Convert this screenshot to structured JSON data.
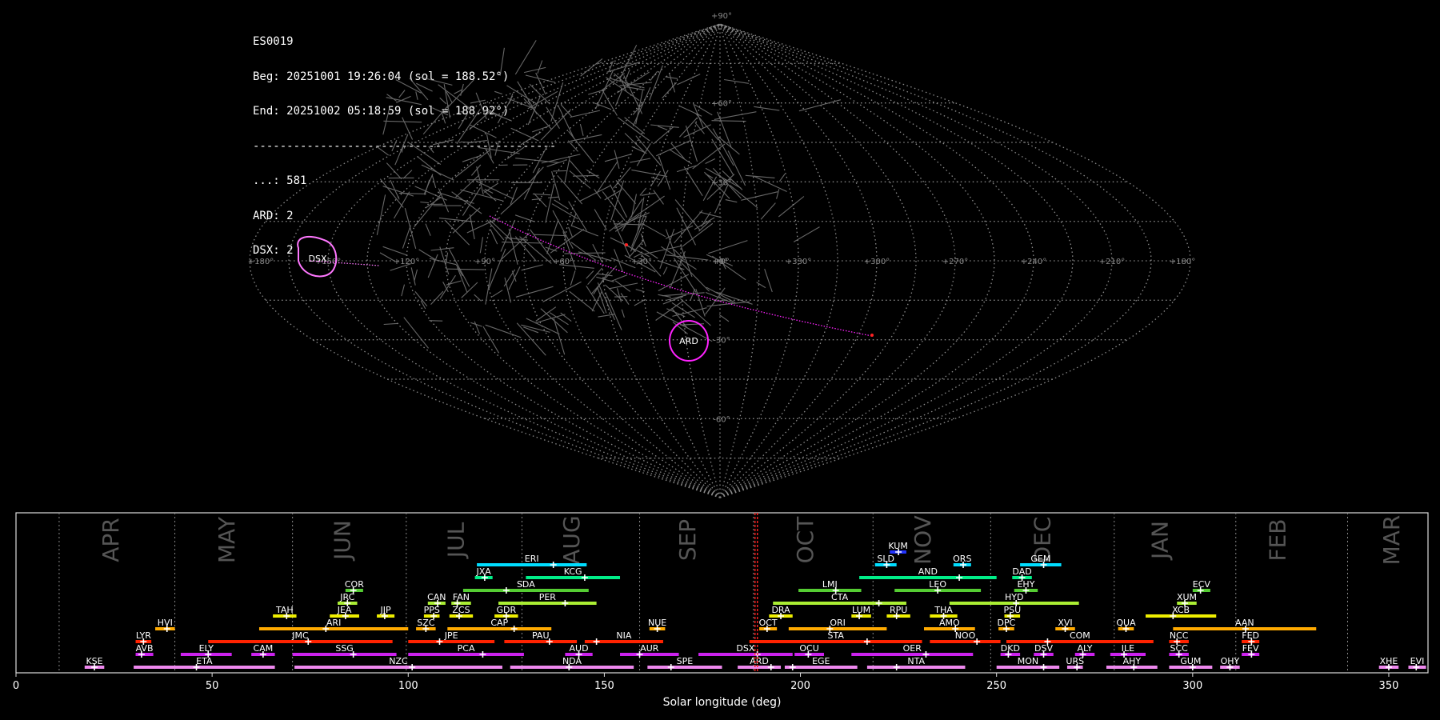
{
  "info": {
    "station": "ES0019",
    "begin": "Beg: 20251001 19:26:04 (sol = 188.52°)",
    "end": "End: 20251002 05:18:59 (sol = 188.92°)",
    "separator": "---------------------------------------------",
    "counts": [
      "...: 581",
      "ARD: 2",
      "DSX: 2"
    ]
  },
  "chart_data": [
    {
      "type": "scatter",
      "projection": "sinusoidal",
      "lat_ticks": [
        "+90°",
        "+60°",
        "+30°",
        "+0°",
        "-30°",
        "-60°",
        "-90°"
      ],
      "lon_ticks": [
        "+180°",
        "+150°",
        "+120°",
        "+90°",
        "+60°",
        "+30°",
        "+0°",
        "+330°",
        "+300°",
        "+270°",
        "+240°",
        "+210°",
        "+180°"
      ],
      "radiants": [
        {
          "code": "DSX",
          "color": "#ff77ff"
        },
        {
          "code": "ARD",
          "color": "#ff22ff"
        }
      ]
    },
    {
      "type": "bar",
      "xlabel": "Solar longitude (deg)",
      "xlim": [
        0,
        360
      ],
      "xticks": [
        0,
        50,
        100,
        150,
        200,
        250,
        300,
        350
      ],
      "months": [
        {
          "label": "APR",
          "x": 24.5
        },
        {
          "label": "MAY",
          "x": 54
        },
        {
          "label": "JUN",
          "x": 83.5
        },
        {
          "label": "JUL",
          "x": 112.5
        },
        {
          "label": "AUG",
          "x": 142
        },
        {
          "label": "SEP",
          "x": 171.5
        },
        {
          "label": "OCT",
          "x": 201.5
        },
        {
          "label": "NOV",
          "x": 231.5
        },
        {
          "label": "DEC",
          "x": 262
        },
        {
          "label": "JAN",
          "x": 292
        },
        {
          "label": "FEB",
          "x": 322
        },
        {
          "label": "MAR",
          "x": 351
        }
      ],
      "month_boundaries": [
        11,
        40.5,
        70.5,
        99.5,
        129,
        159,
        188,
        218.5,
        248.5,
        280,
        311,
        339.5
      ],
      "current_sol": 188.72,
      "showers": [
        {
          "code": "KUM",
          "start": 222.8,
          "end": 227,
          "peak": 225,
          "row": 9,
          "color": "#2233ff"
        },
        {
          "code": "ERI",
          "start": 117.5,
          "end": 145.5,
          "peak": 137,
          "row": 8,
          "color": "#00ddff"
        },
        {
          "code": "SLD",
          "start": 219,
          "end": 224.5,
          "peak": 222,
          "row": 8,
          "color": "#00ddff"
        },
        {
          "code": "ORS",
          "start": 239,
          "end": 243.5,
          "peak": 241.5,
          "row": 8,
          "color": "#00ddff"
        },
        {
          "code": "GEM",
          "start": 256,
          "end": 266.5,
          "peak": 262,
          "row": 8,
          "color": "#00ddff"
        },
        {
          "code": "JXA",
          "start": 117,
          "end": 121.5,
          "peak": 119.5,
          "row": 7,
          "color": "#00ee88"
        },
        {
          "code": "KCG",
          "start": 130,
          "end": 154,
          "peak": 145,
          "row": 7,
          "color": "#00ee88"
        },
        {
          "code": "AND",
          "start": 215,
          "end": 250,
          "peak": 240.5,
          "row": 7,
          "color": "#00ee88"
        },
        {
          "code": "DAD",
          "start": 254,
          "end": 259,
          "peak": 256.5,
          "row": 7,
          "color": "#00ee88"
        },
        {
          "code": "COR",
          "start": 84,
          "end": 88.5,
          "peak": 86,
          "row": 6,
          "color": "#55cc33"
        },
        {
          "code": "SDA",
          "start": 114,
          "end": 146,
          "peak": 125,
          "row": 6,
          "color": "#55cc33"
        },
        {
          "code": "LMI",
          "start": 199.5,
          "end": 215.5,
          "peak": 209,
          "row": 6,
          "color": "#55cc33"
        },
        {
          "code": "LEO",
          "start": 224,
          "end": 246,
          "peak": 235,
          "row": 6,
          "color": "#55cc33"
        },
        {
          "code": "EHY",
          "start": 254.5,
          "end": 260.5,
          "peak": 257.5,
          "row": 6,
          "color": "#55cc33"
        },
        {
          "code": "ECV",
          "start": 300,
          "end": 304.5,
          "peak": 302,
          "row": 6,
          "color": "#55cc33"
        },
        {
          "code": "JRC",
          "start": 82,
          "end": 87,
          "peak": 84.5,
          "row": 5,
          "color": "#aaee33"
        },
        {
          "code": "CAN",
          "start": 105,
          "end": 109.5,
          "peak": 107.5,
          "row": 5,
          "color": "#aaee33"
        },
        {
          "code": "FAN",
          "start": 111,
          "end": 116,
          "peak": 112.5,
          "row": 5,
          "color": "#aaee33"
        },
        {
          "code": "PER",
          "start": 123,
          "end": 148,
          "peak": 140,
          "row": 5,
          "color": "#aaee33"
        },
        {
          "code": "CTA",
          "start": 193,
          "end": 227,
          "peak": 220,
          "row": 5,
          "color": "#aaee33"
        },
        {
          "code": "HYD",
          "start": 238,
          "end": 271,
          "peak": 255,
          "row": 5,
          "color": "#aaee33"
        },
        {
          "code": "XUM",
          "start": 296,
          "end": 301,
          "peak": 298,
          "row": 5,
          "color": "#aaee33"
        },
        {
          "code": "TAH",
          "start": 65.5,
          "end": 71.5,
          "peak": 69,
          "row": 4,
          "color": "#eeee00"
        },
        {
          "code": "JEA",
          "start": 80,
          "end": 87.5,
          "peak": 84,
          "row": 4,
          "color": "#eeee00"
        },
        {
          "code": "JJP",
          "start": 92,
          "end": 96.5,
          "peak": 94,
          "row": 4,
          "color": "#eeee00"
        },
        {
          "code": "PPS",
          "start": 104,
          "end": 108,
          "peak": 106.5,
          "row": 4,
          "color": "#eeee00"
        },
        {
          "code": "ZCS",
          "start": 110.5,
          "end": 116.5,
          "peak": 113,
          "row": 4,
          "color": "#eeee00"
        },
        {
          "code": "GDR",
          "start": 122,
          "end": 128,
          "peak": 125,
          "row": 4,
          "color": "#eeee00"
        },
        {
          "code": "DRA",
          "start": 192,
          "end": 198,
          "peak": 195,
          "row": 4,
          "color": "#eeee00"
        },
        {
          "code": "LUM",
          "start": 213,
          "end": 218,
          "peak": 215,
          "row": 4,
          "color": "#eeee00"
        },
        {
          "code": "RPU",
          "start": 222,
          "end": 228,
          "peak": 224.5,
          "row": 4,
          "color": "#eeee00"
        },
        {
          "code": "THA",
          "start": 233,
          "end": 240,
          "peak": 236.5,
          "row": 4,
          "color": "#eeee00"
        },
        {
          "code": "PSU",
          "start": 252,
          "end": 256,
          "peak": 253.5,
          "row": 4,
          "color": "#eeee00"
        },
        {
          "code": "XCB",
          "start": 288,
          "end": 306,
          "peak": 295,
          "row": 4,
          "color": "#eeee00"
        },
        {
          "code": "HVI",
          "start": 35.5,
          "end": 40.5,
          "peak": 38.5,
          "row": 3,
          "color": "#ffaa00"
        },
        {
          "code": "ARI",
          "start": 62,
          "end": 100,
          "peak": 79,
          "row": 3,
          "color": "#ffaa00"
        },
        {
          "code": "SZC",
          "start": 102,
          "end": 107,
          "peak": 104.5,
          "row": 3,
          "color": "#ffaa00"
        },
        {
          "code": "CAP",
          "start": 110,
          "end": 136.5,
          "peak": 127,
          "row": 3,
          "color": "#ffaa00"
        },
        {
          "code": "NUE",
          "start": 161.5,
          "end": 165.5,
          "peak": 163.5,
          "row": 3,
          "color": "#ffaa00"
        },
        {
          "code": "OCT",
          "start": 189.5,
          "end": 194,
          "peak": 191.5,
          "row": 3,
          "color": "#ffaa00"
        },
        {
          "code": "ORI",
          "start": 197,
          "end": 222,
          "peak": 207.5,
          "row": 3,
          "color": "#ffaa00"
        },
        {
          "code": "AMO",
          "start": 231.5,
          "end": 244.5,
          "peak": 239.5,
          "row": 3,
          "color": "#ffaa00"
        },
        {
          "code": "DPC",
          "start": 250.5,
          "end": 254.5,
          "peak": 252.5,
          "row": 3,
          "color": "#ffaa00"
        },
        {
          "code": "XVI",
          "start": 265,
          "end": 270,
          "peak": 267.5,
          "row": 3,
          "color": "#ffaa00"
        },
        {
          "code": "QUA",
          "start": 281,
          "end": 285,
          "peak": 283,
          "row": 3,
          "color": "#ffaa00"
        },
        {
          "code": "AAN",
          "start": 295,
          "end": 331.5,
          "peak": 313.5,
          "row": 3,
          "color": "#ffaa00"
        },
        {
          "code": "LYR",
          "start": 30.5,
          "end": 34.5,
          "peak": 32.5,
          "row": 2,
          "color": "#ff2200"
        },
        {
          "code": "JMC",
          "start": 49,
          "end": 96,
          "peak": 74.5,
          "row": 2,
          "color": "#ff2200"
        },
        {
          "code": "JPE",
          "start": 100,
          "end": 122,
          "peak": 108,
          "row": 2,
          "color": "#ff2200"
        },
        {
          "code": "PAU",
          "start": 124.5,
          "end": 143,
          "peak": 136,
          "row": 2,
          "color": "#ff2200"
        },
        {
          "code": "NIA",
          "start": 145,
          "end": 165,
          "peak": 148,
          "row": 2,
          "color": "#ff2200"
        },
        {
          "code": "STA",
          "start": 187,
          "end": 231,
          "peak": 217,
          "row": 2,
          "color": "#ff2200"
        },
        {
          "code": "NOO",
          "start": 233,
          "end": 251,
          "peak": 245,
          "row": 2,
          "color": "#ff2200"
        },
        {
          "code": "COM",
          "start": 252.5,
          "end": 290,
          "peak": 263,
          "row": 2,
          "color": "#ff2200"
        },
        {
          "code": "NCC",
          "start": 294,
          "end": 299,
          "peak": 296,
          "row": 2,
          "color": "#ff2200"
        },
        {
          "code": "FED",
          "start": 312.5,
          "end": 317,
          "peak": 315,
          "row": 2,
          "color": "#ff2200"
        },
        {
          "code": "AVB",
          "start": 30.5,
          "end": 35,
          "peak": 32,
          "row": 1,
          "color": "#cc22ee"
        },
        {
          "code": "ELY",
          "start": 42,
          "end": 55,
          "peak": 49,
          "row": 1,
          "color": "#cc22ee"
        },
        {
          "code": "CAM",
          "start": 60,
          "end": 66,
          "peak": 63,
          "row": 1,
          "color": "#cc22ee"
        },
        {
          "code": "SSG",
          "start": 70.5,
          "end": 97,
          "peak": 86,
          "row": 1,
          "color": "#cc22ee"
        },
        {
          "code": "PCA",
          "start": 100,
          "end": 129.5,
          "peak": 119,
          "row": 1,
          "color": "#cc22ee"
        },
        {
          "code": "AUD",
          "start": 140,
          "end": 147,
          "peak": 143.5,
          "row": 1,
          "color": "#cc22ee"
        },
        {
          "code": "AUR",
          "start": 154,
          "end": 169,
          "peak": 159,
          "row": 1,
          "color": "#cc22ee"
        },
        {
          "code": "DSX",
          "start": 174,
          "end": 198,
          "peak": 189,
          "row": 1,
          "color": "#cc22ee"
        },
        {
          "code": "OCU",
          "start": 198.5,
          "end": 206,
          "peak": 202,
          "row": 1,
          "color": "#cc22ee"
        },
        {
          "code": "OER",
          "start": 213,
          "end": 244,
          "peak": 232,
          "row": 1,
          "color": "#cc22ee"
        },
        {
          "code": "DKD",
          "start": 251,
          "end": 256,
          "peak": 253,
          "row": 1,
          "color": "#cc22ee"
        },
        {
          "code": "DSV",
          "start": 259.5,
          "end": 264.5,
          "peak": 262,
          "row": 1,
          "color": "#cc22ee"
        },
        {
          "code": "ALY",
          "start": 270,
          "end": 275,
          "peak": 272,
          "row": 1,
          "color": "#cc22ee"
        },
        {
          "code": "ILE",
          "start": 279,
          "end": 288,
          "peak": 282.5,
          "row": 1,
          "color": "#cc22ee"
        },
        {
          "code": "SCC",
          "start": 294,
          "end": 299,
          "peak": 296.5,
          "row": 1,
          "color": "#cc22ee"
        },
        {
          "code": "FEV",
          "start": 312.5,
          "end": 317,
          "peak": 315,
          "row": 1,
          "color": "#cc22ee"
        },
        {
          "code": "KSE",
          "start": 17.5,
          "end": 22.5,
          "peak": 20,
          "row": 0,
          "color": "#ee88ee"
        },
        {
          "code": "ETA",
          "start": 30,
          "end": 66,
          "peak": 46,
          "row": 0,
          "color": "#ee88ee"
        },
        {
          "code": "NZC",
          "start": 71,
          "end": 124,
          "peak": 101,
          "row": 0,
          "color": "#ee88ee"
        },
        {
          "code": "NDA",
          "start": 126,
          "end": 157.5,
          "peak": 141,
          "row": 0,
          "color": "#ee88ee"
        },
        {
          "code": "SPE",
          "start": 161,
          "end": 180,
          "peak": 167,
          "row": 0,
          "color": "#ee88ee"
        },
        {
          "code": "ARD",
          "start": 184,
          "end": 195,
          "peak": 192.5,
          "row": 0,
          "color": "#ee88ee"
        },
        {
          "code": "EGE",
          "start": 196,
          "end": 214.5,
          "peak": 198,
          "row": 0,
          "color": "#ee88ee"
        },
        {
          "code": "NTA",
          "start": 217,
          "end": 242,
          "peak": 224.5,
          "row": 0,
          "color": "#ee88ee"
        },
        {
          "code": "MON",
          "start": 250,
          "end": 266,
          "peak": 262,
          "row": 0,
          "color": "#ee88ee"
        },
        {
          "code": "URS",
          "start": 268,
          "end": 272,
          "peak": 270.5,
          "row": 0,
          "color": "#ee88ee"
        },
        {
          "code": "AHY",
          "start": 278,
          "end": 291,
          "peak": 285,
          "row": 0,
          "color": "#ee88ee"
        },
        {
          "code": "GUM",
          "start": 294,
          "end": 305,
          "peak": 300,
          "row": 0,
          "color": "#ee88ee"
        },
        {
          "code": "OHY",
          "start": 307,
          "end": 312,
          "peak": 309.5,
          "row": 0,
          "color": "#ee88ee"
        },
        {
          "code": "XHE",
          "start": 347.5,
          "end": 352.5,
          "peak": 350,
          "row": 0,
          "color": "#ee88ee"
        },
        {
          "code": "EVI",
          "start": 355,
          "end": 359.5,
          "peak": 357,
          "row": 0,
          "color": "#ee88ee"
        }
      ]
    }
  ]
}
